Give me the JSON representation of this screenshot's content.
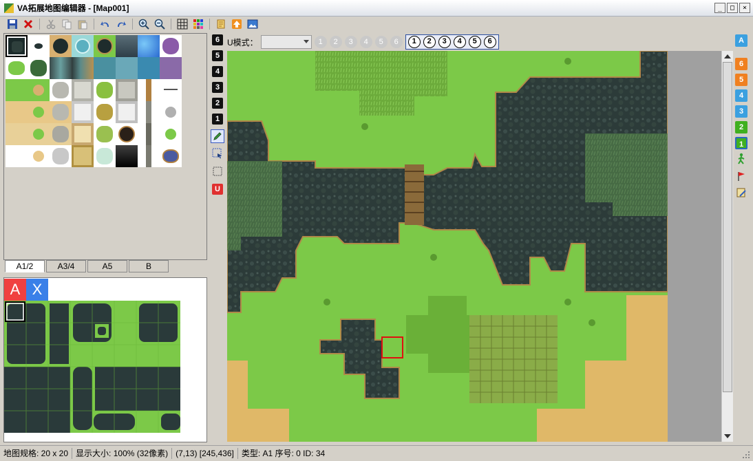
{
  "window": {
    "title": "VA拓展地图编辑器 - [Map001]",
    "controls": [
      "_",
      "□",
      "×"
    ]
  },
  "toolbar": {
    "buttons": [
      "save-icon",
      "close-icon",
      "cut-icon",
      "copy-icon",
      "paste-icon",
      "undo-icon",
      "redo-icon",
      "zoom-in-icon",
      "zoom-out-icon",
      "grid-icon",
      "palette-icon",
      "scroll-icon",
      "upload-icon",
      "image-icon"
    ]
  },
  "palette": {
    "tabs": [
      "A1/2",
      "A3/4",
      "A5",
      "B"
    ],
    "active_tab": "A1/2"
  },
  "autotile_panel": {
    "a_label": "A",
    "x_label": "X"
  },
  "layers_left": [
    "6",
    "5",
    "4",
    "3",
    "2",
    "1"
  ],
  "layers_right": [
    {
      "label": "A",
      "color": "#3ba0e0"
    },
    {
      "label": "6",
      "color": "#f08020"
    },
    {
      "label": "5",
      "color": "#f08020"
    },
    {
      "label": "4",
      "color": "#3ba0e0"
    },
    {
      "label": "3",
      "color": "#3ba0e0"
    },
    {
      "label": "2",
      "color": "#40b020"
    },
    {
      "label": "1",
      "color": "#40b020"
    }
  ],
  "umode": {
    "label": "U模式：",
    "selected": "",
    "disabled_slots": [
      "1",
      "2",
      "3",
      "4",
      "5",
      "6"
    ],
    "active_slots": [
      "1",
      "2",
      "3",
      "4",
      "5",
      "6"
    ]
  },
  "status": {
    "map_size": "地图规格: 20 x 20",
    "display_size": "显示大小: 100% (32像素)",
    "coords": "(7,13) [245,436]",
    "tile_info": "类型: A1 序号: 0 ID: 34"
  }
}
